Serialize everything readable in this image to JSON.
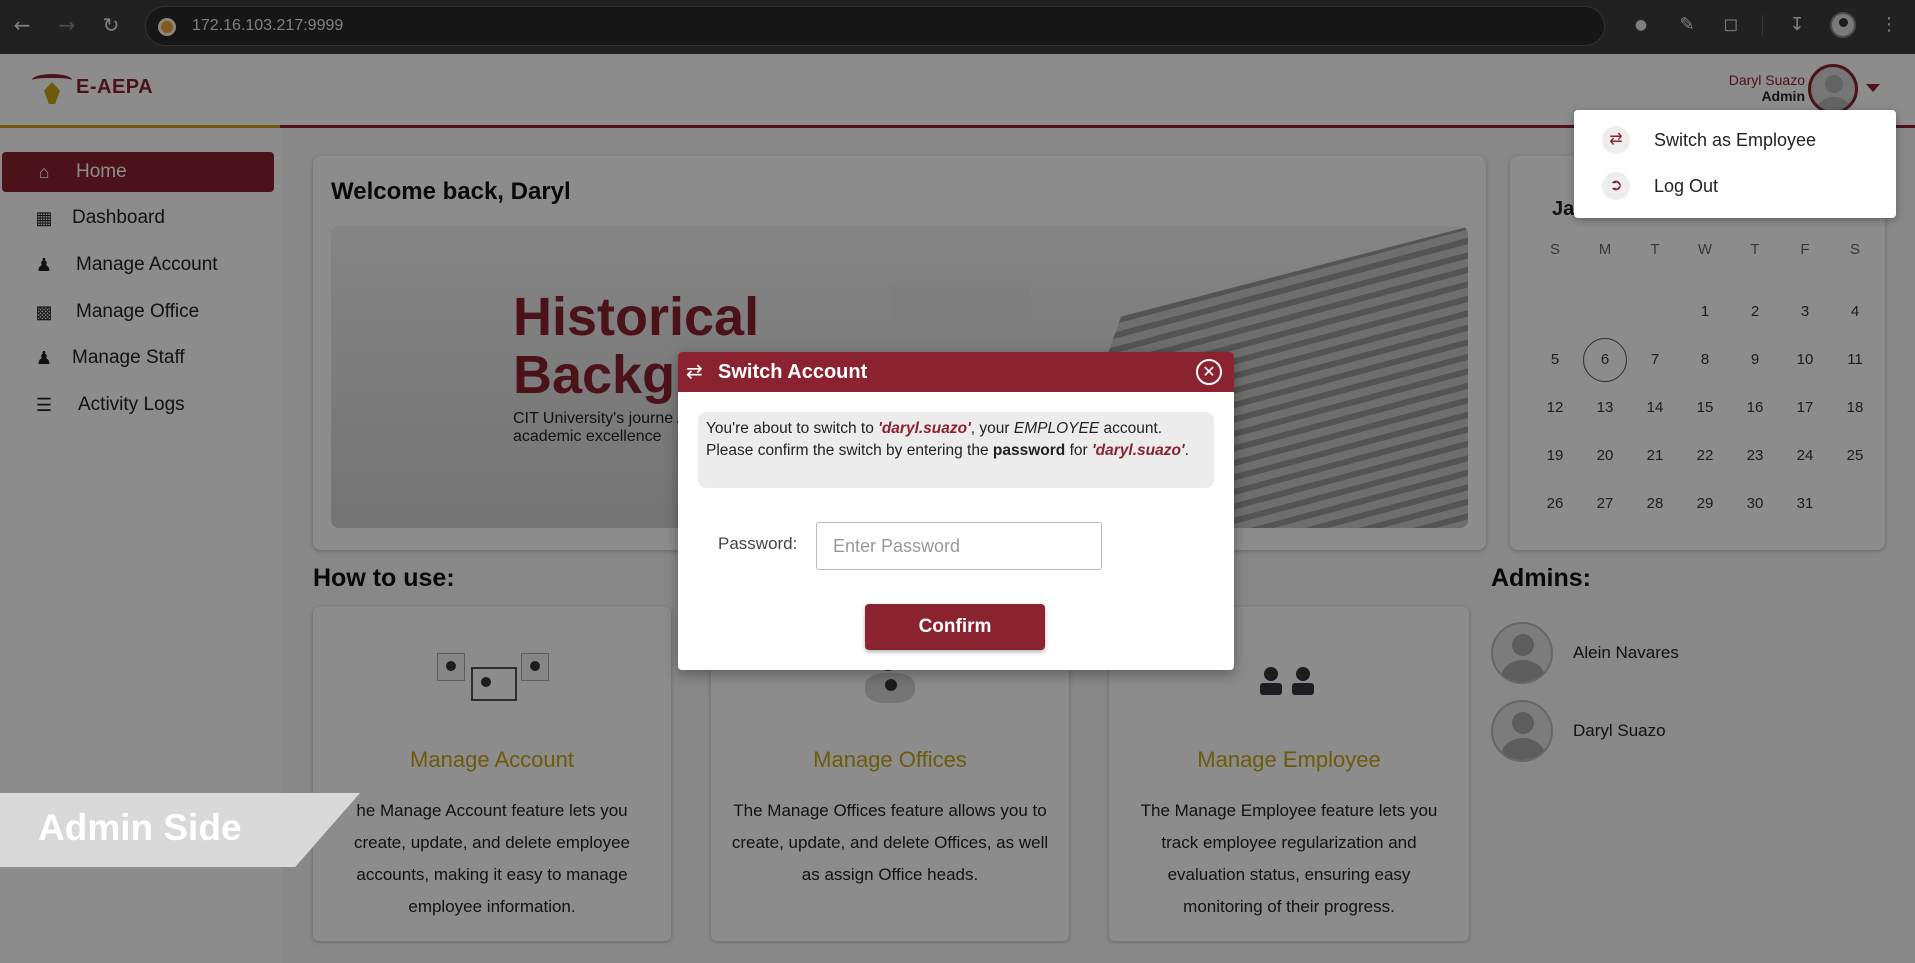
{
  "browser": {
    "url": "172.16.103.217:9999"
  },
  "app": {
    "logo_text": "E-AEPA",
    "user_name": "Daryl Suazo",
    "user_role": "Admin"
  },
  "sidebar": {
    "items": [
      {
        "label": "Home",
        "icon": "home-icon"
      },
      {
        "label": "Dashboard",
        "icon": "dashboard-icon"
      },
      {
        "label": "Manage Account",
        "icon": "users-icon"
      },
      {
        "label": "Manage Office",
        "icon": "building-icon"
      },
      {
        "label": "Manage Staff",
        "icon": "person-icon"
      },
      {
        "label": "Activity Logs",
        "icon": "list-icon"
      }
    ]
  },
  "welcome": {
    "title": "Welcome back, Daryl",
    "banner_heading_1": "Historical",
    "banner_heading_2": "Backg",
    "banner_sub": "CIT University's journe A tale of growth, innov academic excellence"
  },
  "calendar": {
    "month": "Ja",
    "weekdays": [
      "S",
      "M",
      "T",
      "W",
      "T",
      "F",
      "S"
    ],
    "today": "6"
  },
  "how_to_use": {
    "title": "How to use:",
    "cards": [
      {
        "title": "Manage Account",
        "desc": "he Manage Account feature lets you create, update, and delete employee accounts, making it easy to manage employee information."
      },
      {
        "title": "Manage Offices",
        "desc": "The Manage Offices feature allows you to create, update, and delete Offices, as well as assign Office heads."
      },
      {
        "title": "Manage Employee",
        "desc": "The Manage Employee feature lets you track employee regularization and evaluation status, ensuring easy monitoring of their progress."
      }
    ]
  },
  "admins": {
    "title": "Admins:",
    "list": [
      "Alein Navares",
      "Daryl Suazo"
    ]
  },
  "dropdown": {
    "switch_label": "Switch as Employee",
    "logout_label": "Log Out"
  },
  "overlay_tag": "Admin Side",
  "modal": {
    "title": "Switch Account",
    "msg_1": "You're about to switch to ",
    "msg_account": "'daryl.suazo'",
    "msg_2": ", your ",
    "msg_type": "EMPLOYEE",
    "msg_3": " account. Please confirm the switch by entering the ",
    "msg_pw": "password",
    "msg_4": " for ",
    "msg_account2": "'daryl.suazo'",
    "msg_5": ".",
    "password_label": "Password:",
    "password_placeholder": "Enter Password",
    "confirm_label": "Confirm"
  },
  "colors": {
    "primary": "#8b2230",
    "accent_gold": "#c8a415"
  }
}
